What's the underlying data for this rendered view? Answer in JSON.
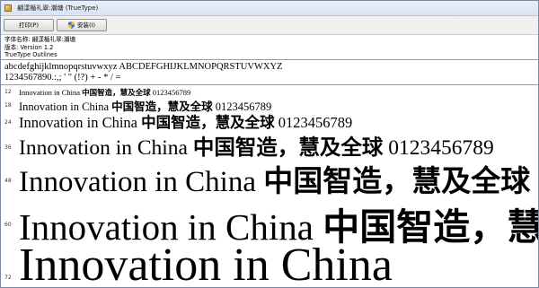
{
  "window": {
    "title": "翩漾楯礼翠:潮塘 (TrueType)"
  },
  "toolbar": {
    "print_label": "打印(P)",
    "install_label": "安装(I)"
  },
  "info": {
    "font_name_line": "字体名称: 翩漾楯礼翠:潮塘",
    "version_line": "版本: Version 1.2",
    "type_line": "TrueType Outlines"
  },
  "charset": {
    "letters": "abcdefghijklmnopqrstuvwxyz ABCDEFGHIJKLMNOPQRSTUVWXYZ",
    "digits": "1234567890.:,; ' \" (!?) + - * / ="
  },
  "samples": [
    {
      "size": "12",
      "latin": "Innovation in China ",
      "cjk": "中国智造，慧及全球",
      "num": " 0123456789"
    },
    {
      "size": "18",
      "latin": "Innovation in China ",
      "cjk": "中国智造，慧及全球",
      "num": " 0123456789"
    },
    {
      "size": "24",
      "latin": "Innovation in China ",
      "cjk": "中国智造，慧及全球",
      "num": " 0123456789"
    },
    {
      "size": "36",
      "latin": "Innovation in China ",
      "cjk": "中国智造，慧及全球",
      "num": " 0123456789"
    },
    {
      "size": "48",
      "latin": "Innovation in China ",
      "cjk": "中国智造，慧及全球",
      "num": ""
    },
    {
      "size": "60",
      "latin": "Innovation in China ",
      "cjk": "中国智造，慧及全球",
      "num": ""
    },
    {
      "size": "72",
      "latin": "Innovation in China",
      "cjk": "",
      "num": ""
    }
  ]
}
